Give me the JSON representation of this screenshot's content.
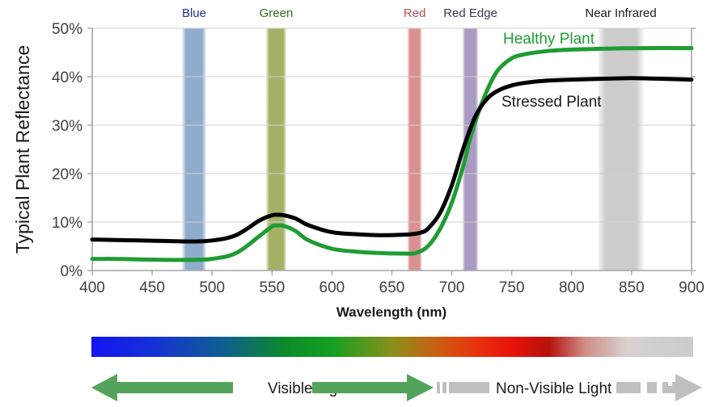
{
  "chart_data": {
    "type": "line",
    "title": "",
    "xlabel": "Wavelength (nm)",
    "ylabel": "Typical Plant Reflectance",
    "xlim": [
      400,
      900
    ],
    "ylim": [
      0,
      50
    ],
    "xticks": [
      "400",
      "450",
      "500",
      "550",
      "600",
      "650",
      "700",
      "750",
      "800",
      "850",
      "900"
    ],
    "yticks": [
      "0%",
      "10%",
      "20%",
      "30%",
      "40%",
      "50%"
    ],
    "grid": true,
    "legend_position": "inline-annotation",
    "series": [
      {
        "name": "Healthy Plant",
        "color": "#1f9c34",
        "label_color": "#1f9c34",
        "x": [
          400,
          420,
          440,
          460,
          480,
          500,
          520,
          540,
          550,
          555,
          560,
          570,
          580,
          600,
          620,
          640,
          660,
          670,
          680,
          690,
          700,
          710,
          715,
          720,
          725,
          730,
          735,
          740,
          750,
          760,
          780,
          800,
          830,
          860,
          900
        ],
        "y": [
          2.4,
          2.4,
          2.3,
          2.2,
          2.2,
          2.4,
          3.6,
          7.2,
          9.1,
          9.3,
          9.2,
          8.1,
          6.3,
          4.5,
          3.9,
          3.6,
          3.5,
          3.6,
          5.0,
          8.5,
          14.0,
          22.0,
          27.0,
          31.0,
          34.5,
          37.5,
          40.0,
          41.8,
          43.8,
          44.6,
          45.3,
          45.6,
          45.8,
          45.9,
          45.9
        ]
      },
      {
        "name": "Stressed Plant",
        "color": "#000000",
        "label_color": "#1a1a1a",
        "x": [
          400,
          420,
          440,
          460,
          480,
          500,
          520,
          540,
          550,
          555,
          560,
          570,
          580,
          600,
          620,
          640,
          660,
          670,
          675,
          680,
          690,
          700,
          710,
          720,
          730,
          740,
          750,
          760,
          780,
          800,
          830,
          850,
          870,
          900
        ],
        "y": [
          6.4,
          6.3,
          6.2,
          6.1,
          6.0,
          6.2,
          7.3,
          10.4,
          11.4,
          11.5,
          11.4,
          10.7,
          9.4,
          7.9,
          7.5,
          7.3,
          7.4,
          7.6,
          7.9,
          8.6,
          11.8,
          17.6,
          25.5,
          32.0,
          35.6,
          37.3,
          38.2,
          38.7,
          39.2,
          39.4,
          39.6,
          39.7,
          39.6,
          39.4
        ]
      }
    ],
    "bands": [
      {
        "name": "Blue",
        "label": "Blue",
        "start": 475,
        "end": 495,
        "color": "#8faccd",
        "label_color": "#20309c"
      },
      {
        "name": "Green",
        "label": "Green",
        "start": 545,
        "end": 562,
        "color": "#a5b167",
        "label_color": "#326e1d"
      },
      {
        "name": "Red",
        "label": "Red",
        "start": 663,
        "end": 675,
        "color": "#d99191",
        "label_color": "#c0504d"
      },
      {
        "name": "Red Edge",
        "label": "Red Edge",
        "start": 709,
        "end": 722,
        "color": "#a99bc1",
        "label_color": "#3a3a55"
      },
      {
        "name": "Near Infrared",
        "label": "Near Infrared",
        "start": 822,
        "end": 860,
        "color": "#cccccc",
        "label_color": "#1a1a1a"
      }
    ]
  },
  "spectrum_bar": {
    "name": "visible-to-nir-spectrum",
    "stops": [
      {
        "pos": 0,
        "color": "#1414f0"
      },
      {
        "pos": 10,
        "color": "#1530d8"
      },
      {
        "pos": 22,
        "color": "#0f5f8f"
      },
      {
        "pos": 32,
        "color": "#0b8a2a"
      },
      {
        "pos": 40,
        "color": "#14a021"
      },
      {
        "pos": 50,
        "color": "#8a8f1a"
      },
      {
        "pos": 58,
        "color": "#cf5a12"
      },
      {
        "pos": 64,
        "color": "#e8320c"
      },
      {
        "pos": 70,
        "color": "#e81209"
      },
      {
        "pos": 76,
        "color": "#b5120b"
      },
      {
        "pos": 82,
        "color": "#cf8d86"
      },
      {
        "pos": 89,
        "color": "#d8d2d0"
      },
      {
        "pos": 94,
        "color": "#cfcfcf"
      },
      {
        "pos": 100,
        "color": "#cccccc"
      }
    ]
  },
  "legend_arrows": {
    "visible": {
      "label": "Visible Light",
      "color": "#53a45a"
    },
    "non_visible": {
      "label": "Non-Visible Light",
      "color": "#bfbfbf"
    }
  }
}
